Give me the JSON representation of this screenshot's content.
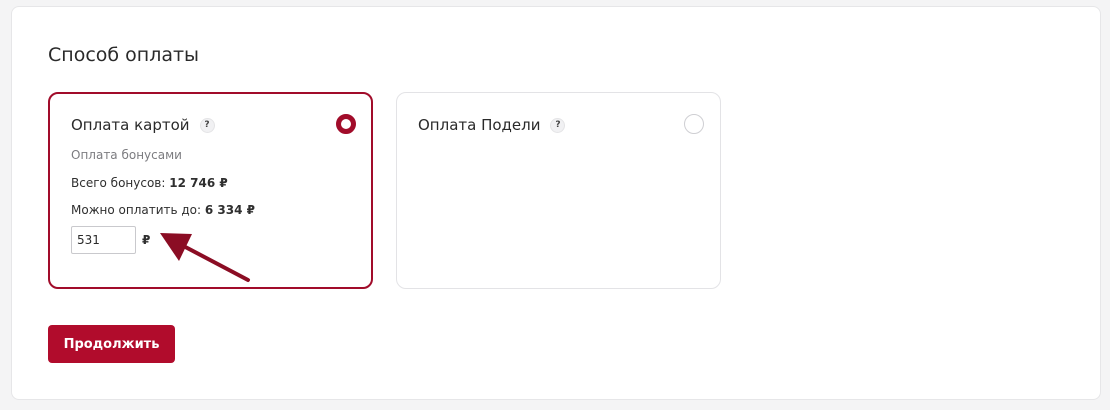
{
  "section": {
    "title": "Способ оплаты"
  },
  "payment_methods": [
    {
      "label": "Оплата картой",
      "help": "?",
      "selected": true
    },
    {
      "label": "Оплата Подели",
      "help": "?",
      "selected": false
    }
  ],
  "bonus": {
    "subtitle": "Оплата бонусами",
    "total_label": "Всего бонусов:",
    "total_value": "12 746 ₽",
    "max_label": "Можно оплатить до:",
    "max_value": "6 334 ₽",
    "input_value": "531",
    "currency": "₽"
  },
  "actions": {
    "continue_label": "Продолжить"
  },
  "colors": {
    "accent": "#a10c2a",
    "button": "#b10c2c",
    "arrow": "#8b0d24"
  },
  "icons": {
    "help": "question-icon",
    "arrow": "arrow-annotation-icon"
  }
}
